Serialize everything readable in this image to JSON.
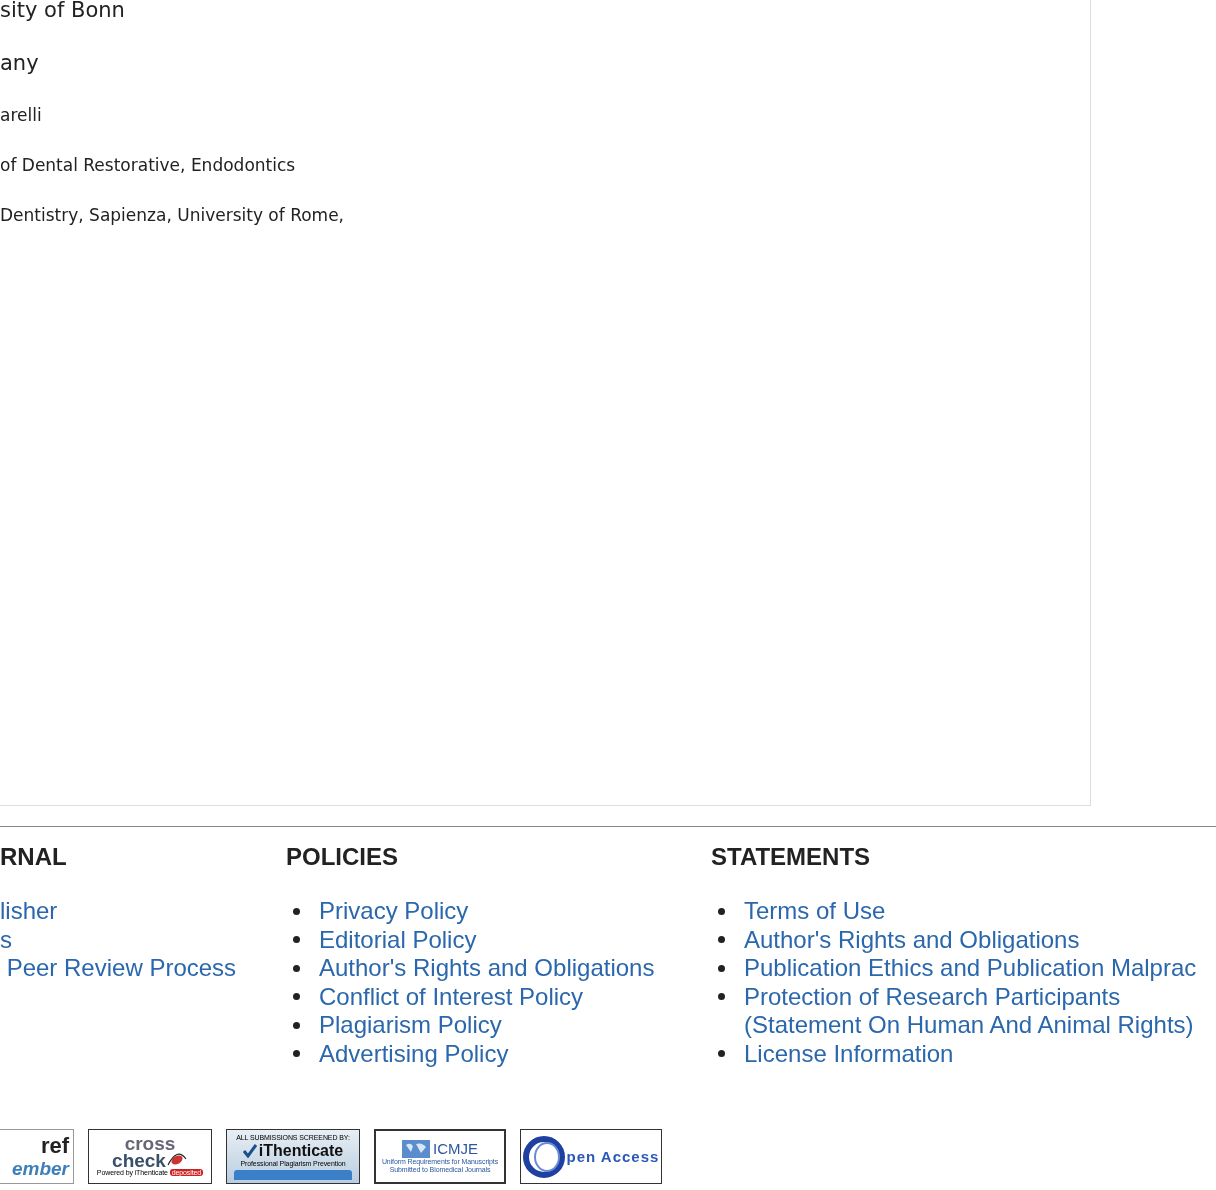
{
  "affiliations": [
    {
      "text": "sity of Bonn",
      "kind": "large"
    },
    {
      "text": "any",
      "kind": "large"
    },
    {
      "text": "arelli",
      "kind": "small"
    },
    {
      "text": "of Dental Restorative, Endodontics",
      "kind": "small"
    },
    {
      "text": "Dentistry, Sapienza, University of Rome,",
      "kind": "small"
    }
  ],
  "footer": {
    "columns": [
      {
        "heading": "RNAL",
        "kind": "plain",
        "links": [
          "lisher",
          "s",
          " Peer Review Process"
        ]
      },
      {
        "heading": "POLICIES",
        "kind": "bulleted",
        "links": [
          "Privacy Policy",
          "Editorial Policy",
          "Author's Rights and Obligations",
          "Conflict of Interest Policy",
          "Plagiarism Policy",
          "Advertising Policy"
        ]
      },
      {
        "heading": "STATEMENTS",
        "kind": "bulleted",
        "links": [
          "Terms of Use",
          "Author's Rights and Obligations",
          "Publication Ethics and Publication Malprac",
          "Protection of Research Participants (Statement On Human And Animal Rights)",
          "License Information"
        ]
      }
    ]
  },
  "badges": [
    {
      "kind": "crossref",
      "texts": [
        "ref",
        "ember"
      ]
    },
    {
      "kind": "crosscheck",
      "texts": [
        "cross",
        "check",
        "Powered by iThenticate",
        "deposited"
      ]
    },
    {
      "kind": "ithenticate",
      "texts": [
        "ALL SUBMISSIONS SCREENED BY:",
        "iThenticate",
        "Professional Plagiarism Prevention"
      ]
    },
    {
      "kind": "icmje",
      "texts": [
        "ICMJE",
        "Uniform Requirements for Manuscripts Submitted to Biomedical Journals"
      ]
    },
    {
      "kind": "openaccess",
      "texts": [
        "pen Access"
      ]
    }
  ]
}
